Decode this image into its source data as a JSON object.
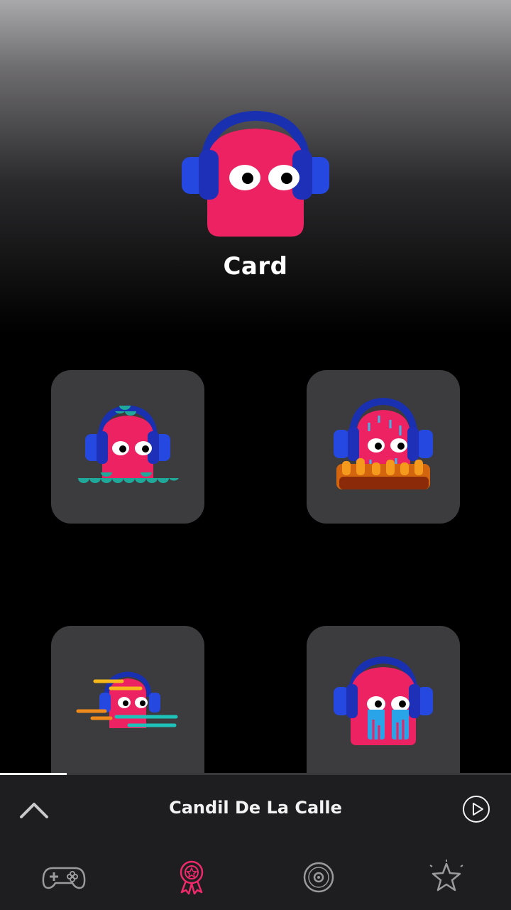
{
  "hero": {
    "title": "Card",
    "avatar_icon": "pink-ghost-with-headphones-icon"
  },
  "tiles": [
    {
      "icon": "ghost-underwater-waves-icon"
    },
    {
      "icon": "ghost-rain-fire-icon"
    },
    {
      "icon": "ghost-speed-lines-icon"
    },
    {
      "icon": "ghost-crying-icon"
    }
  ],
  "player": {
    "track_title": "Candil De La Calle",
    "progress_fraction": 0.13,
    "expand_icon": "chevron-up-icon",
    "play_icon": "play-circle-icon"
  },
  "tabs": [
    {
      "icon": "gamepad-icon",
      "active": false
    },
    {
      "icon": "award-ribbon-icon",
      "active": true
    },
    {
      "icon": "vinyl-disc-icon",
      "active": false
    },
    {
      "icon": "star-icon",
      "active": false
    }
  ],
  "colors": {
    "ghost_pink": "#ec2262",
    "headphones_blue": "#1e36c8",
    "tile_bg": "#3c3b3e",
    "active_tab": "#ee2a6b",
    "inactive_tab": "#9b9a9d"
  }
}
